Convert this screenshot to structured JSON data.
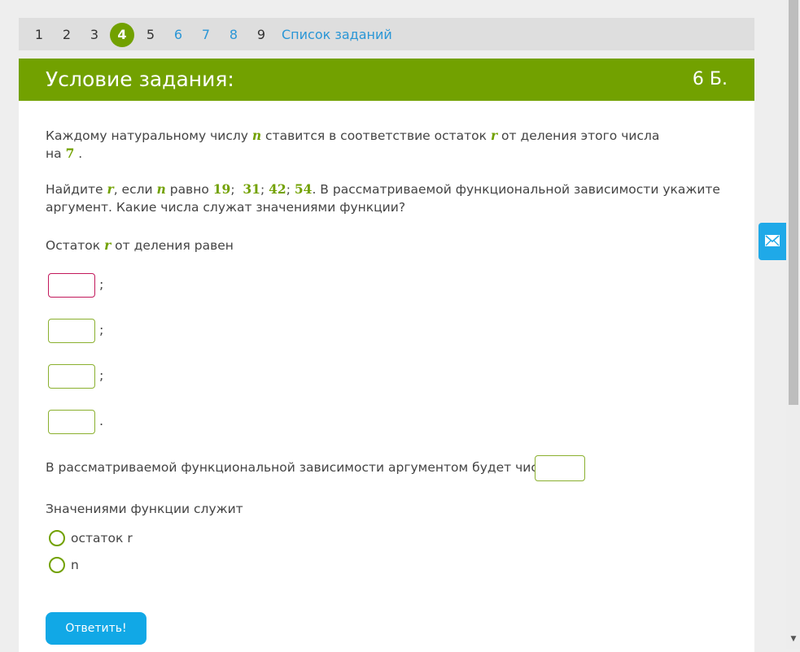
{
  "nav": {
    "items": [
      {
        "label": "1",
        "state": "normal"
      },
      {
        "label": "2",
        "state": "normal"
      },
      {
        "label": "3",
        "state": "normal"
      },
      {
        "label": "4",
        "state": "current"
      },
      {
        "label": "5",
        "state": "normal"
      },
      {
        "label": "6",
        "state": "link"
      },
      {
        "label": "7",
        "state": "link"
      },
      {
        "label": "8",
        "state": "link"
      },
      {
        "label": "9",
        "state": "normal"
      }
    ],
    "tasks_link": "Список заданий"
  },
  "header": {
    "title": "Условие задания:",
    "points": "6 Б."
  },
  "problem": {
    "p1_a": "Каждому натуральному числу ",
    "var_n": "n",
    "p1_b": " ставится в соответствие  остаток ",
    "var_r": "r",
    "p1_c": " от деления этого числа",
    "p1_d": "на ",
    "num_7": "7",
    "p1_e": " .",
    "p2_a": "Найдите ",
    "p2_b": ", если ",
    "p2_c": " равно ",
    "num_19": "19",
    "sep1": ";  ",
    "num_31": "31",
    "sep2": "; ",
    "num_42": "42",
    "sep3": "; ",
    "num_54": "54",
    "p2_d": ". В рассматриваемой функциональной зависимости укажите",
    "p2_e": "аргумент. Какие числа служат значениями функции?",
    "p3_a": "Остаток ",
    "p3_b": " от деления равен"
  },
  "answers": {
    "remainders": [
      {
        "value": "",
        "punct": ";"
      },
      {
        "value": "",
        "punct": ";"
      },
      {
        "value": "",
        "punct": ";"
      },
      {
        "value": "",
        "punct": "."
      }
    ],
    "argument_label": "В рассматриваемой функциональной зависимости  аргументом будет число",
    "argument_value": "",
    "values_label": "Значениями функции служит",
    "options": [
      "остаток r",
      "n"
    ]
  },
  "submit_label": "Ответить!",
  "colors": {
    "accent_green": "#72a100",
    "link_blue": "#2a96d6",
    "button_blue": "#11a8e6",
    "active_field_border": "#c2185b"
  },
  "icons": {
    "mail": "envelope-icon"
  }
}
